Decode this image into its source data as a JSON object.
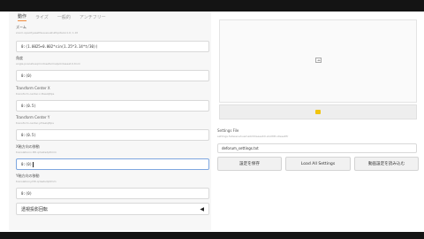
{
  "tabs": [
    {
      "label": "動作",
      "active": true
    },
    {
      "label": "ライズ",
      "active": false
    },
    {
      "label": "一般的",
      "active": false
    },
    {
      "label": "アンチフリー",
      "active": false
    }
  ],
  "fields": [
    {
      "label": "ズーム",
      "hint": "zoom.opacityasetfeuuasuatulfopitsolo1.0; 1.9t",
      "value": "0:(1.0025+0.002*sin(1.25*3.14*t/30))"
    },
    {
      "label": "角度",
      "hint": "angle.pvsoatuaqmndosefarmalpolidasaet.0.tinm",
      "value": "0:(0)"
    },
    {
      "label": "Transform Center X",
      "hint": "transform.center.x.ttaalqttps",
      "value": "0:(0.5)"
    },
    {
      "label": "Transform Center Y",
      "hint": "transform.center.y.ttaalqttps",
      "value": "0:(0.5)"
    },
    {
      "label": "X軸方向の移動",
      "hint": "translationx.tttl.qrlastsdptlmm",
      "value": "0:(0)",
      "focused": true
    },
    {
      "label": "Y軸方向の移動",
      "hint": "translationy.tttl.qrlastsdptlmm",
      "value": "0:(0)"
    }
  ],
  "dropdown": {
    "label": "透視投影回転"
  },
  "right": {
    "settings_label": "Settings File",
    "settings_hint": "settings.fallsssnehuamaibhtilaasatdl.atutlttt.stlesatlfr",
    "settings_value": "deforum_settings.txt",
    "buttons": {
      "save": "設定を保存",
      "load_all": "Load All Settings",
      "load_video": "動画設定を読み込む"
    }
  },
  "colors": {
    "accent": "#f08a3c",
    "chrome": "#141414",
    "panel": "#f7f7f7"
  }
}
